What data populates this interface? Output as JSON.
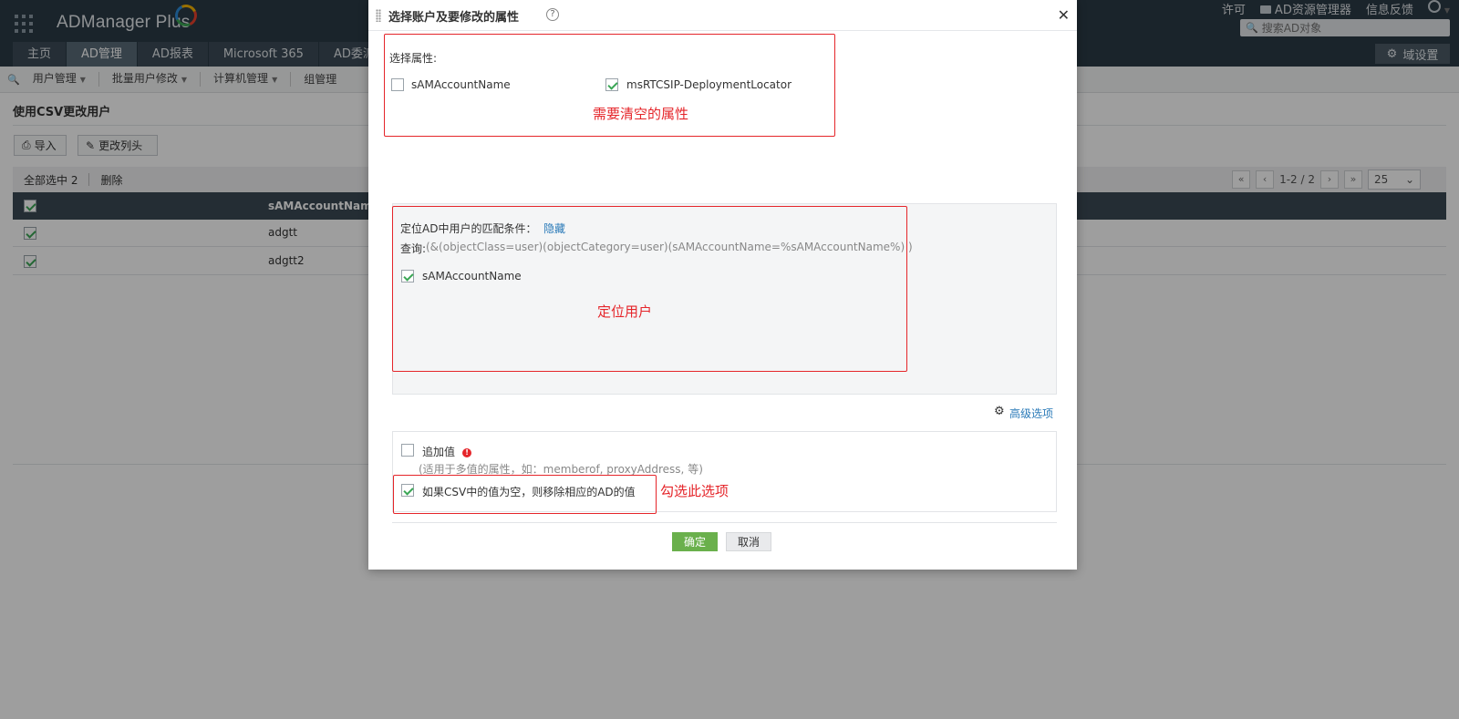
{
  "app": {
    "logo": "ADManager Plus",
    "tabs": [
      "主页",
      "AD管理",
      "AD报表",
      "Microsoft 365",
      "AD委派"
    ],
    "active_tab": 1,
    "top_links": {
      "license": "许可",
      "ad_explorer": "AD资源管理器",
      "feedback": "信息反馈"
    },
    "search_placeholder": "搜索AD对象",
    "domain_settings": "域设置"
  },
  "subnav": [
    "用户管理",
    "批量用户修改",
    "计算机管理",
    "组管理"
  ],
  "page": {
    "title": "使用CSV更改用户",
    "import_label": "导入",
    "change_header_label": "更改列头",
    "selected_all": "全部选中 2",
    "delete_label": "删除",
    "pager_text": "1-2 / 2",
    "page_size": "25",
    "column_header": "sAMAccountName",
    "rows": [
      "adgtt",
      "adgtt2"
    ]
  },
  "dialog": {
    "title": "选择账户及要修改的属性",
    "select_attr_label": "选择属性:",
    "attr1": "sAMAccountName",
    "attr2": "msRTCSIP-DeploymentLocator",
    "annot_clear_attr": "需要清空的属性",
    "match_label": "定位AD中用户的匹配条件：",
    "hide_link": "隐藏",
    "query_label": "查询:",
    "query_value": "(&(objectClass=user)(objectCategory=user)(sAMAccountName=%sAMAccountName%) )",
    "match_attr": "sAMAccountName",
    "annot_locate_user": "定位用户",
    "advanced_link": "高级选项",
    "append_label": "追加值",
    "append_hint": "(适用于多值的属性，如：memberof, proxyAddress, 等)",
    "remove_label": "如果CSV中的值为空，则移除相应的AD的值",
    "annot_check_option": "勾选此选项",
    "ok": "确定",
    "cancel": "取消"
  }
}
